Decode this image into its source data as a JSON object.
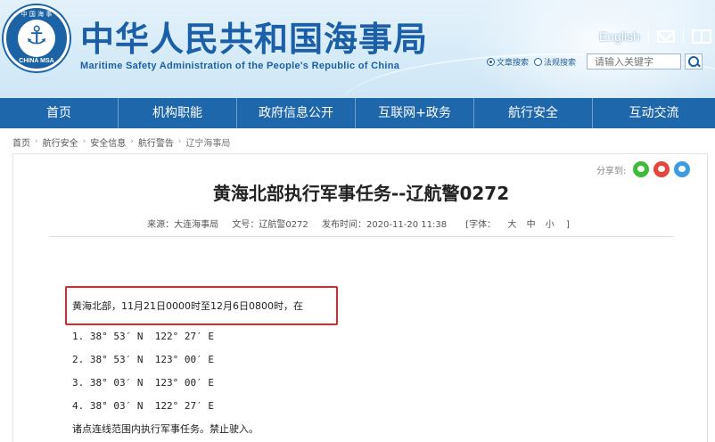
{
  "header": {
    "logo_ring_top": "中 国 海 事",
    "logo_ring_bottom": "CHINA MSA",
    "title_cn": "中华人民共和国海事局",
    "title_en": "Maritime Safety Administration of the People's Republic of China",
    "lang_link": "English",
    "search": {
      "option1": "文章搜索",
      "option2": "法规搜索",
      "selected": "文章搜索",
      "placeholder": "请输入关键字"
    }
  },
  "nav": {
    "items": [
      "首页",
      "机构职能",
      "政府信息公开",
      "互联网+政务",
      "航行安全",
      "互动交流"
    ]
  },
  "breadcrumb": {
    "items": [
      "首页",
      "航行安全",
      "安全信息",
      "航行警告",
      "辽宁海事局"
    ]
  },
  "article": {
    "share_label": "分享到:",
    "title": "黄海北部执行军事任务--辽航警0272",
    "meta": {
      "source": "来源：大连海事局",
      "doc_no": "文号：辽航警0272",
      "publish_time": "发布时间：2020-11-20 11:38",
      "font_label": "[字体：",
      "font_large": "大",
      "font_medium": "中",
      "font_small": "小",
      "font_close": "]"
    },
    "intro": "黄海北部，11月21日0000时至12月6日0800时，在",
    "points": [
      "1. 38° 53′ N  122° 27′ E",
      "2. 38° 53′ N  123° 00′ E",
      "3. 38° 03′ N  123° 00′ E",
      "4. 38° 03′ N  122° 27′ E"
    ],
    "closing": "诸点连线范围内执行军事任务。禁止驶入。"
  },
  "colors": {
    "nav_bg": "#1f67ab",
    "brand_blue": "#1b5fa8",
    "highlight_red": "#e0262b"
  }
}
